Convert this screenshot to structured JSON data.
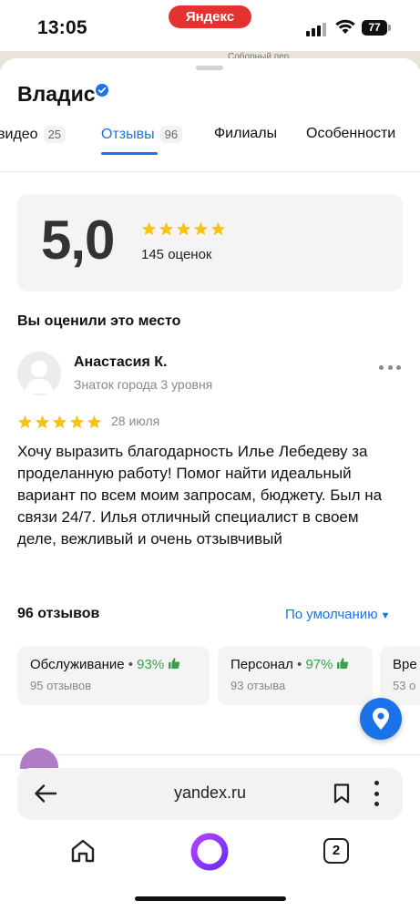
{
  "status_bar": {
    "time": "13:05",
    "browser_badge": "Яндекс",
    "battery": "77",
    "icons": [
      "cellular-signal-icon",
      "wifi-icon",
      "battery-icon"
    ]
  },
  "map": {
    "street_label": "Соборный пер."
  },
  "organization": {
    "name": "Владис",
    "verified_icon": "verified-check-icon"
  },
  "tabs": [
    {
      "label": "видео",
      "count": "25"
    },
    {
      "label": "Отзывы",
      "count": "96",
      "active": true
    },
    {
      "label": "Филиалы"
    },
    {
      "label": "Особенности"
    }
  ],
  "rating_summary": {
    "value": "5,0",
    "stars": 5,
    "count_text": "145 оценок"
  },
  "your_rating": {
    "heading": "Вы оценили это место"
  },
  "review": {
    "author": "Анастасия К.",
    "level": "Знаток города 3 уровня",
    "stars": 5,
    "date": "28 июля",
    "text": "Хочу выразить благодарность Илье Лебедеву за проделанную работу! Помог найти идеальный вариант по всем моим запросам, бюджету. Был на связи 24/7. Илья отличный специалист в своем деле, вежливый и очень отзывчивый"
  },
  "reviews_list": {
    "count_text": "96 отзывов",
    "sort_label": "По умолчанию",
    "aspects": [
      {
        "name": "Обслуживание",
        "percent": "93%",
        "sub": "95 отзывов"
      },
      {
        "name": "Персонал",
        "percent": "97%",
        "sub": "93 отзыва"
      },
      {
        "name": "Вре",
        "percent": "",
        "sub": "53 о"
      }
    ]
  },
  "browser": {
    "url": "yandex.ru",
    "tab_count": "2",
    "icons": [
      "back-arrow-icon",
      "bookmark-icon",
      "more-vertical-icon",
      "home-icon",
      "alice-icon",
      "tabs-icon"
    ]
  },
  "colors": {
    "accent": "#1a73e8",
    "star": "#f6c411",
    "positive": "#3aa14a",
    "brand_red": "#e5312f"
  }
}
